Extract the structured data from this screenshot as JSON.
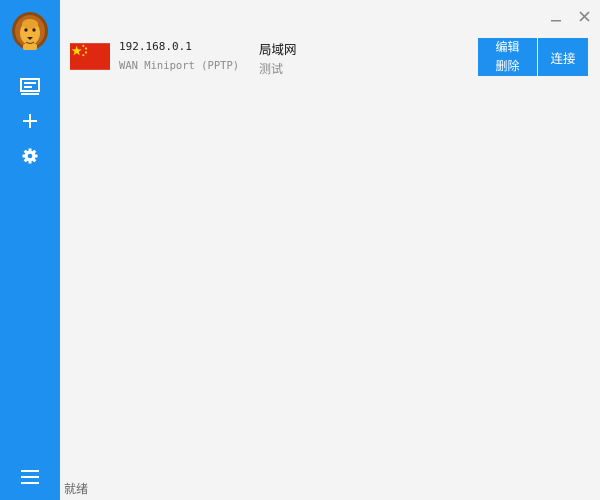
{
  "sidebar": {
    "logo_icon": "lion-logo-icon",
    "items": [
      {
        "name": "server-list",
        "icon": "monitor-icon"
      },
      {
        "name": "add",
        "icon": "plus-icon"
      },
      {
        "name": "settings",
        "icon": "gear-icon"
      }
    ],
    "menu_icon": "hamburger-menu-icon"
  },
  "window": {
    "minimize_icon": "minimize-icon",
    "close_icon": "close-icon"
  },
  "connection": {
    "flag_icon": "china-flag-icon",
    "ip": "192.168.0.1",
    "protocol": "WAN Miniport (PPTP)",
    "name": "局域网",
    "description": "测试",
    "edit_label": "编辑",
    "delete_label": "删除",
    "connect_label": "连接"
  },
  "status": {
    "text": "就绪"
  },
  "colors": {
    "sidebar": "#1e90ef",
    "background": "#f4f4f4",
    "flag_red": "#de2910",
    "flag_yellow": "#ffde00"
  }
}
